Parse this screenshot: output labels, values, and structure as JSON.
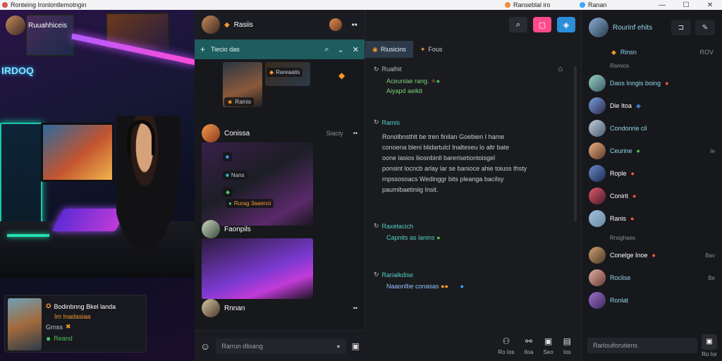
{
  "titlebar": {
    "left_title": "Ronteing Ironlontlemotngin",
    "mid_title": "Ranseblal iro",
    "right_title": "Ranan",
    "minimize": "—",
    "maximize": "☐",
    "close": "✕"
  },
  "hero": {
    "top_user": "Ruuahhiceis",
    "sign_text": "IRDOQ",
    "notification": {
      "line1": "Bodinbnng Bkel landa",
      "line2": "Im Inadasiaa",
      "line3": "Grnss",
      "line4": "Reand"
    }
  },
  "feed": {
    "header_title": "Rasiis",
    "toolbar_label": "Tiecio das",
    "posts": [
      {
        "user": "",
        "meta": "",
        "chip1": "",
        "chip2": "Ramis",
        "chip3": ""
      },
      {
        "user": "Conissa",
        "meta": "Siaciy",
        "chip1": "",
        "chip2": "Nans",
        "chip3": "Rurag 3aaenoi"
      },
      {
        "user": "Faonpils",
        "meta": "",
        "chip1": "",
        "chip2": "",
        "chip3": ""
      },
      {
        "user": "Rnnan",
        "meta": "",
        "chip1": "",
        "chip2": "",
        "chip3": ""
      }
    ],
    "input_placeholder": "Rarrun dlisang",
    "chip_top": "Rareaatis"
  },
  "chat": {
    "tabs": [
      {
        "label": "Riusicins"
      },
      {
        "label": "Fous"
      }
    ],
    "messages": [
      {
        "who": "Rualhit",
        "body1": "Aceuniae rang.",
        "body2": "Aiyapd aeikit"
      },
      {
        "who": "Ramis",
        "body1": "Ronolbnsthlt be tren finilan Goebien I hame",
        "body2": "conoena bleni blidartulcl Inalteseu lo altr bate",
        "body3": "oone lasios liiosnbinll barerisetiontoisgel",
        "body4": "ponsint locncb arlay lar se banioce ahie toiuss thsty",
        "body5": "rnpssosoacs Wedinggr bits pleanga bacilsy",
        "body6": "paumibaetiniig Insit."
      },
      {
        "who": "Raxetacich",
        "body1": "Capnits as lanins"
      },
      {
        "who": "Rarialkdise",
        "body1": "Naaonlbe conasas"
      }
    ],
    "actions": [
      {
        "label": "Ro Ios"
      },
      {
        "label": "Iloa"
      },
      {
        "label": "Seo"
      },
      {
        "label": "Ios"
      }
    ]
  },
  "users": {
    "head_name": "Rourinf ehits",
    "status": "Rinsn",
    "status_right": "ROV",
    "section1": "Ramios",
    "section2": "Rnsghaes",
    "list1": [
      {
        "name": "Daos Inngis boing",
        "right": ""
      },
      {
        "name": "Die Itoa",
        "right": ""
      },
      {
        "name": "Condonrie cil",
        "right": ""
      },
      {
        "name": "Ceurine",
        "right": "Ie"
      },
      {
        "name": "Rople",
        "right": ""
      },
      {
        "name": "Conirit",
        "right": ""
      },
      {
        "name": "Ranis",
        "right": ""
      }
    ],
    "list2": [
      {
        "name": "Conelge Inoe",
        "right": "Bav"
      },
      {
        "name": "Roclise",
        "right": "Be"
      },
      {
        "name": "Ronlat",
        "right": ""
      }
    ],
    "input_placeholder": "Rarlouiforutiens",
    "bottom_label": "Ro Ior"
  },
  "colors": {
    "accent_teal": "#1d5c5f",
    "tab_active": "#2c3a49",
    "pink_btn": "#ff4b8b",
    "blue_btn": "#2b8ed8"
  }
}
